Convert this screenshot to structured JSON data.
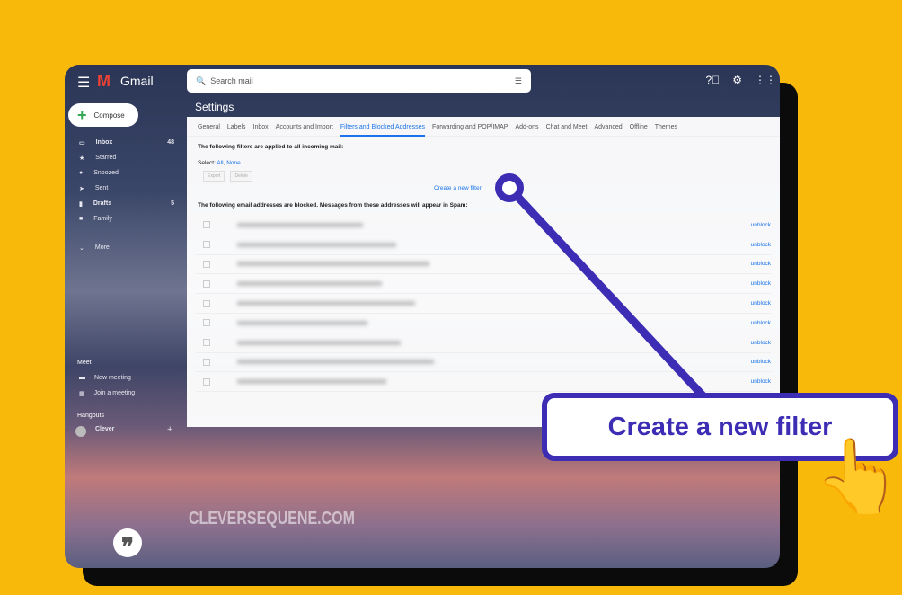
{
  "app": {
    "name": "Gmail",
    "search_placeholder": "Search mail"
  },
  "compose": "Compose",
  "nav": [
    {
      "label": "Inbox",
      "count": "48",
      "icon": "inbox-icon",
      "bold": true
    },
    {
      "label": "Starred",
      "icon": "star-icon"
    },
    {
      "label": "Snoozed",
      "icon": "clock-icon"
    },
    {
      "label": "Sent",
      "icon": "send-icon"
    },
    {
      "label": "Drafts",
      "count": "5",
      "icon": "draft-icon",
      "bold": true
    },
    {
      "label": "Family",
      "icon": "label-icon"
    }
  ],
  "more": "More",
  "meet": {
    "title": "Meet",
    "new_meeting": "New meeting",
    "join_meeting": "Join a meeting"
  },
  "hangouts": {
    "title": "Hangouts",
    "user": "Clever"
  },
  "settings": {
    "title": "Settings",
    "tabs": [
      "General",
      "Labels",
      "Inbox",
      "Accounts and Import",
      "Filters and Blocked Addresses",
      "Forwarding and POP/IMAP",
      "Add-ons",
      "Chat and Meet",
      "Advanced",
      "Offline",
      "Themes"
    ],
    "active_tab": "Filters and Blocked Addresses",
    "filters_heading": "The following filters are applied to all incoming mail:",
    "select_label": "Select:",
    "select_all": "All",
    "select_none": "None",
    "export": "Export",
    "delete": "Delete",
    "create_filter": "Create a new filter",
    "blocked_heading": "The following email addresses are blocked. Messages from these addresses will appear in Spam:",
    "unblock_label": "unblock",
    "blocked_rows": 9
  },
  "watermark": "CLEVERSEQUENE.COM",
  "callout": {
    "text": "Create a new filter",
    "color": "#3d2db5"
  },
  "colors": {
    "background": "#f9b90b",
    "accent": "#3d2db5",
    "link": "#1a73e8"
  }
}
